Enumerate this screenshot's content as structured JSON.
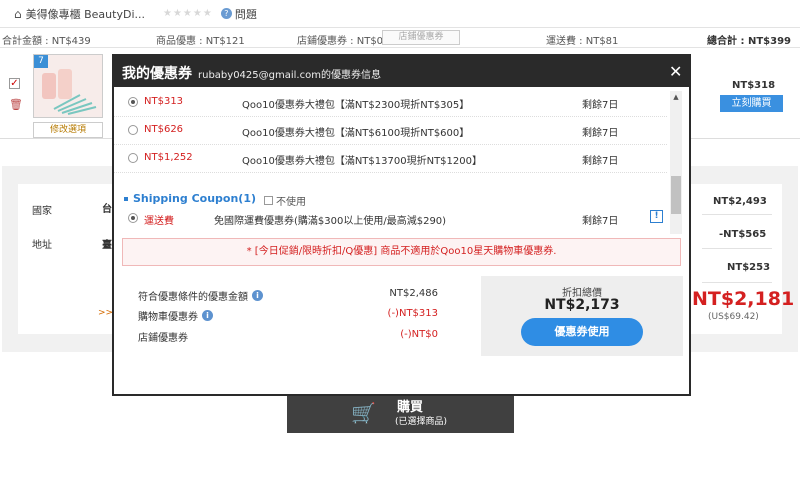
{
  "store": {
    "name": "美得像專櫃 BeautyDi...",
    "help": "問題"
  },
  "summary": {
    "total_amount": "合計金額 : NT$439",
    "item_discount": "商品優惠 : NT$121",
    "store_coupon": "店鋪優惠券 : NT$0",
    "store_coupon_button": "店鋪優惠券",
    "shipping": "運送費 : NT$81",
    "grand_total": "總合計 : NT$399"
  },
  "item": {
    "thumb_badge": "7",
    "edit_button": "修改選項",
    "price": "NT$318",
    "buy_now": "立刻購買"
  },
  "order": {
    "country_label": "國家",
    "country_value": "台",
    "address_label": "地址",
    "address_value": "臺",
    "arrow": ">>",
    "value1": "NT$2,493",
    "value2": "-NT$565",
    "value3": "NT$253",
    "big_total": "NT$2,181",
    "usd": "(US$69.42)"
  },
  "bottom_buy": {
    "title": "購買",
    "sub": "(已選擇商品)"
  },
  "modal": {
    "title": "我的優惠券",
    "subtitle": "rubaby0425@gmail.com的優惠券信息",
    "close": "✕",
    "coupons": [
      {
        "amount": "NT$313",
        "name": "Qoo10優惠券大禮包【滿NT$2300現折NT$305】",
        "remaining": "剩餘7日",
        "selected": true
      },
      {
        "amount": "NT$626",
        "name": "Qoo10優惠券大禮包【滿NT$6100現折NT$600】",
        "remaining": "剩餘7日",
        "selected": false
      },
      {
        "amount": "NT$1,252",
        "name": "Qoo10優惠券大禮包【滿NT$13700現折NT$1200】",
        "remaining": "剩餘7日",
        "selected": false
      }
    ],
    "shipping_heading": "Shipping Coupon(1)",
    "shipping_nouse": "不使用",
    "shipping_coupon": {
      "amount": "運送費",
      "name": "免國際運費優惠券(購滿$300以上使用/最高減$290)",
      "remaining": "剩餘7日",
      "info": "!"
    },
    "notice": "* [今日促銷/限時折扣/Q優惠] 商品不適用於Qoo10星天購物車優惠券.",
    "summary": {
      "eligible_label": "符合優惠條件的優惠金額",
      "eligible_value": "NT$2,486",
      "cart_coupon_label": "購物車優惠券",
      "cart_coupon_value": "(-)NT$313",
      "store_coupon_label": "店鋪優惠券",
      "store_coupon_value": "(-)NT$0",
      "discount_caption": "折扣總價",
      "discount_total": "NT$2,173",
      "apply_button": "優惠券使用"
    }
  }
}
